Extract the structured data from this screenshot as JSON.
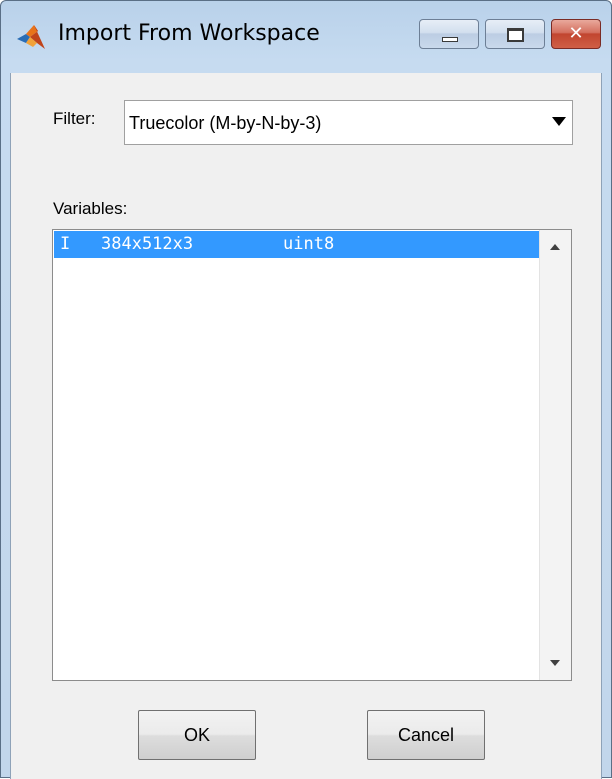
{
  "window": {
    "title": "Import From Workspace",
    "icon": "matlab-logo-icon",
    "controls": {
      "minimize_icon": "minimize-icon",
      "maximize_icon": "maximize-icon",
      "close_glyph": "✕"
    }
  },
  "filter": {
    "label": "Filter:",
    "selected": "Truecolor (M-by-N-by-3)",
    "arrow_icon": "chevron-down-icon"
  },
  "variables": {
    "label": "Variables:",
    "rows": [
      {
        "name": "I",
        "size": "384x512x3",
        "class": "uint8",
        "selected": true
      }
    ],
    "scroll_up_icon": "scroll-up-arrow-icon",
    "scroll_down_icon": "scroll-down-arrow-icon"
  },
  "buttons": {
    "ok": "OK",
    "cancel": "Cancel"
  },
  "colors": {
    "selection": "#3399ff",
    "dialog_bg": "#f0f0f0",
    "frame": "#c6dbf0",
    "close": "#c1452f"
  }
}
